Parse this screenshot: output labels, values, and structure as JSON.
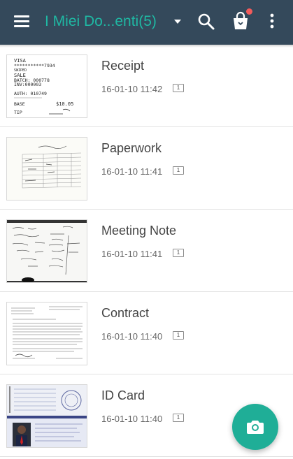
{
  "appbar": {
    "title": "I Miei Do...enti(5)",
    "icons": [
      "menu-icon",
      "dropdown-arrow-icon",
      "search-icon",
      "shopping-bag-icon",
      "more-vert-icon"
    ],
    "accent_color": "#1fb8a3",
    "bar_color": "#34495b",
    "notification_dot_color": "#f35b5b"
  },
  "documents": [
    {
      "title": "Receipt",
      "date": "16-01-10 11:42",
      "pages": "1"
    },
    {
      "title": "Paperwork",
      "date": "16-01-10 11:41",
      "pages": "1"
    },
    {
      "title": "Meeting Note",
      "date": "16-01-10 11:41",
      "pages": "1"
    },
    {
      "title": "Contract",
      "date": "16-01-10 11:40",
      "pages": "1"
    },
    {
      "title": "ID Card",
      "date": "16-01-10 11:40",
      "pages": "1"
    }
  ],
  "receipt_thumb": {
    "lines": [
      "VISA",
      "***********7934",
      "SWIPED",
      "SALE",
      "BATCH: 000778",
      "INV:000003",
      "AUTH: 010749",
      "BASE",
      "$10.05",
      "TIP"
    ]
  },
  "fab": {
    "icon": "camera-icon",
    "color": "#1fae97"
  }
}
